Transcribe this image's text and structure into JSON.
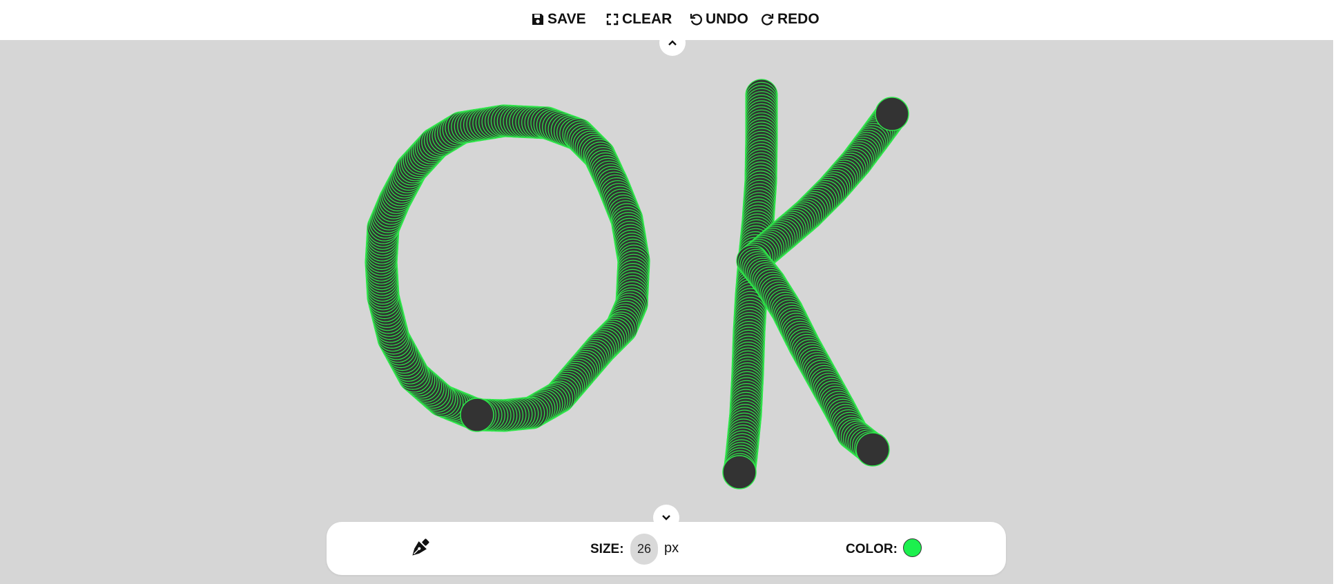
{
  "toolbar": {
    "save_label": "SAVE",
    "clear_label": "CLEAR",
    "undo_label": "UNDO",
    "redo_label": "REDO"
  },
  "canvas": {
    "background": "#d6d6d6",
    "brush_fill": "#333333",
    "brush_stroke": "#2ee84a"
  },
  "bottom_panel": {
    "tool_icon": "pen-icon",
    "size_label": "SIZE:",
    "size_value": "26",
    "size_unit": "px",
    "color_label": "COLOR:",
    "color_value": "#1cf04e"
  }
}
